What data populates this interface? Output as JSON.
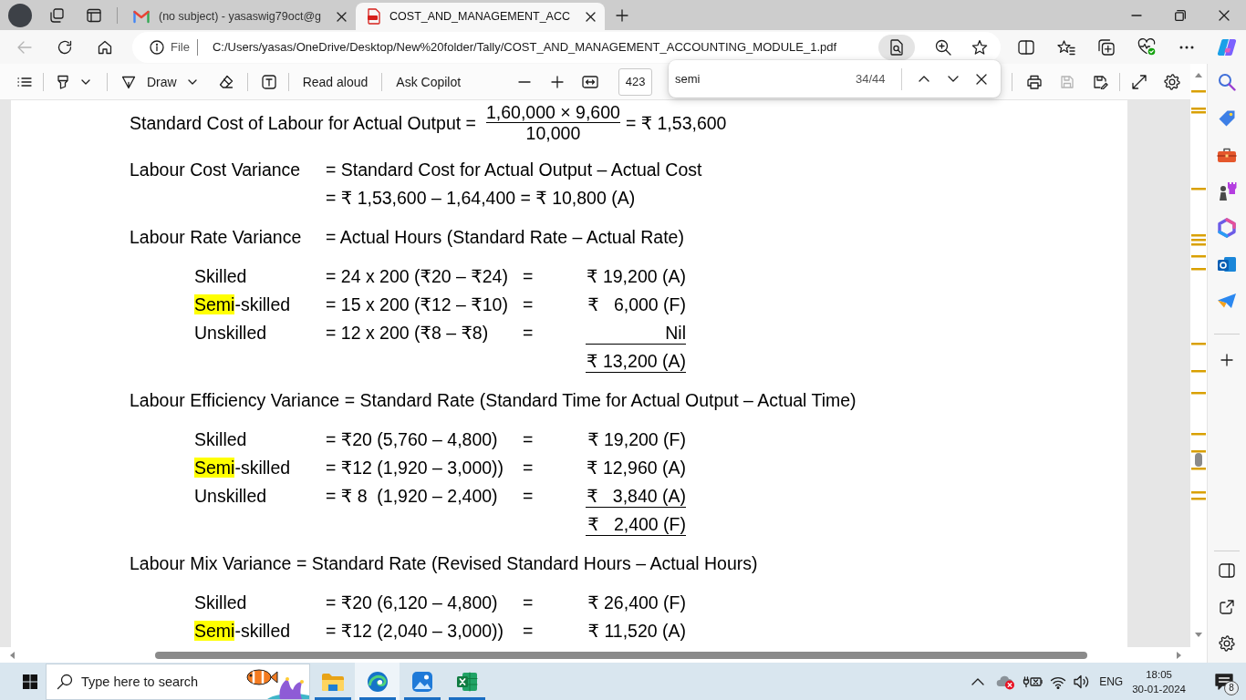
{
  "browser": {
    "tabs": [
      {
        "kind": "mail",
        "title": "(no subject) - yasaswig79oct@g",
        "selected": false
      },
      {
        "kind": "pdf",
        "title": "COST_AND_MANAGEMENT_ACC",
        "selected": true
      }
    ],
    "address_bar": {
      "back_disabled": true,
      "scheme_label": "File",
      "url": "C:/Users/yasas/OneDrive/Desktop/New%20folder/Tally/COST_AND_MANAGEMENT_ACCOUNTING_MODULE_1.pdf"
    }
  },
  "pdf_toolbar": {
    "draw_label": "Draw",
    "read_aloud_label": "Read aloud",
    "ask_copilot_label": "Ask Copilot",
    "page_number": "423",
    "save_disabled": true
  },
  "find_bar": {
    "value": "semi",
    "match_count": "34/44"
  },
  "document": {
    "fraction_formula": {
      "label": "Standard Cost of Labour for Actual Output =",
      "numerator": "1,60,000 × 9,600",
      "denominator": "10,000",
      "result": "= ₹ 1,53,600"
    },
    "sections": [
      {
        "kind": "aligned",
        "label": "Labour Cost Variance",
        "lines": [
          "= Standard Cost for Actual Output – Actual Cost",
          "= ₹ 1,53,600 – 1,64,400 = ₹ 10,800 (A)"
        ]
      },
      {
        "kind": "aligned",
        "label": "Labour Rate Variance",
        "lines": [
          "= Actual Hours (Standard Rate – Actual Rate)"
        ],
        "rows": [
          {
            "label_parts": [
              {
                "text": "Skilled",
                "highlighted": false
              }
            ],
            "formula": "= 24 x 200 (₹20 – ₹24)",
            "equals": "=",
            "amount": "₹ 19,200 (A)",
            "underlined": false
          },
          {
            "label_parts": [
              {
                "text": "Semi",
                "highlighted": true
              },
              {
                "text": "-skilled",
                "highlighted": false
              }
            ],
            "formula": "= 15 x 200 (₹12 – ₹10)",
            "equals": "=",
            "amount": "₹   6,000 (F)",
            "underlined": false
          },
          {
            "label_parts": [
              {
                "text": "Unskilled",
                "highlighted": false
              }
            ],
            "formula": "= 12 x 200 (₹8 – ₹8)",
            "equals": "=",
            "amount": "Nil",
            "underlined": true
          }
        ],
        "total": {
          "amount": "₹ 13,200 (A)",
          "underlined": true
        }
      },
      {
        "kind": "inline",
        "label": "Labour Efficiency Variance",
        "lines": [
          "= Standard Rate (Standard Time for Actual Output – Actual Time)"
        ],
        "rows": [
          {
            "label_parts": [
              {
                "text": "Skilled",
                "highlighted": false
              }
            ],
            "formula": "= ₹20 (5,760 – 4,800)",
            "equals": "=",
            "amount": "₹ 19,200 (F)",
            "underlined": false
          },
          {
            "label_parts": [
              {
                "text": "Semi",
                "highlighted": true
              },
              {
                "text": "-skilled",
                "highlighted": false
              }
            ],
            "formula": "= ₹12 (1,920 – 3,000))",
            "equals": "=",
            "amount": "₹ 12,960 (A)",
            "underlined": false
          },
          {
            "label_parts": [
              {
                "text": "Unskilled",
                "highlighted": false
              }
            ],
            "formula": "= ₹ 8  (1,920 – 2,400)",
            "equals": "=",
            "amount": "₹   3,840 (A)",
            "underlined": true
          }
        ],
        "total": {
          "amount": "₹   2,400 (F)",
          "underlined": true
        }
      },
      {
        "kind": "inline",
        "label": "Labour Mix Variance",
        "lines": [
          "= Standard Rate (Revised Standard Hours – Actual Hours)"
        ],
        "rows": [
          {
            "label_parts": [
              {
                "text": "Skilled",
                "highlighted": false
              }
            ],
            "formula": "= ₹20 (6,120 – 4,800)",
            "equals": "=",
            "amount": "₹ 26,400 (F)",
            "underlined": false
          },
          {
            "label_parts": [
              {
                "text": "Semi",
                "highlighted": true
              },
              {
                "text": "-skilled",
                "highlighted": false
              }
            ],
            "formula": "= ₹12 (2,040 – 3,000))",
            "equals": "=",
            "amount": "₹ 11,520 (A)",
            "underlined": false
          }
        ]
      }
    ]
  },
  "taskbar": {
    "search_placeholder": "Type here to search",
    "apps": [
      {
        "kind": "file_explorer",
        "selected": false
      },
      {
        "kind": "edge",
        "selected": true
      },
      {
        "kind": "photos",
        "selected": false
      },
      {
        "kind": "excel",
        "selected": false
      }
    ],
    "language": "ENG",
    "time": "18:05",
    "date": "30-01-2024",
    "notification_count": "8"
  }
}
